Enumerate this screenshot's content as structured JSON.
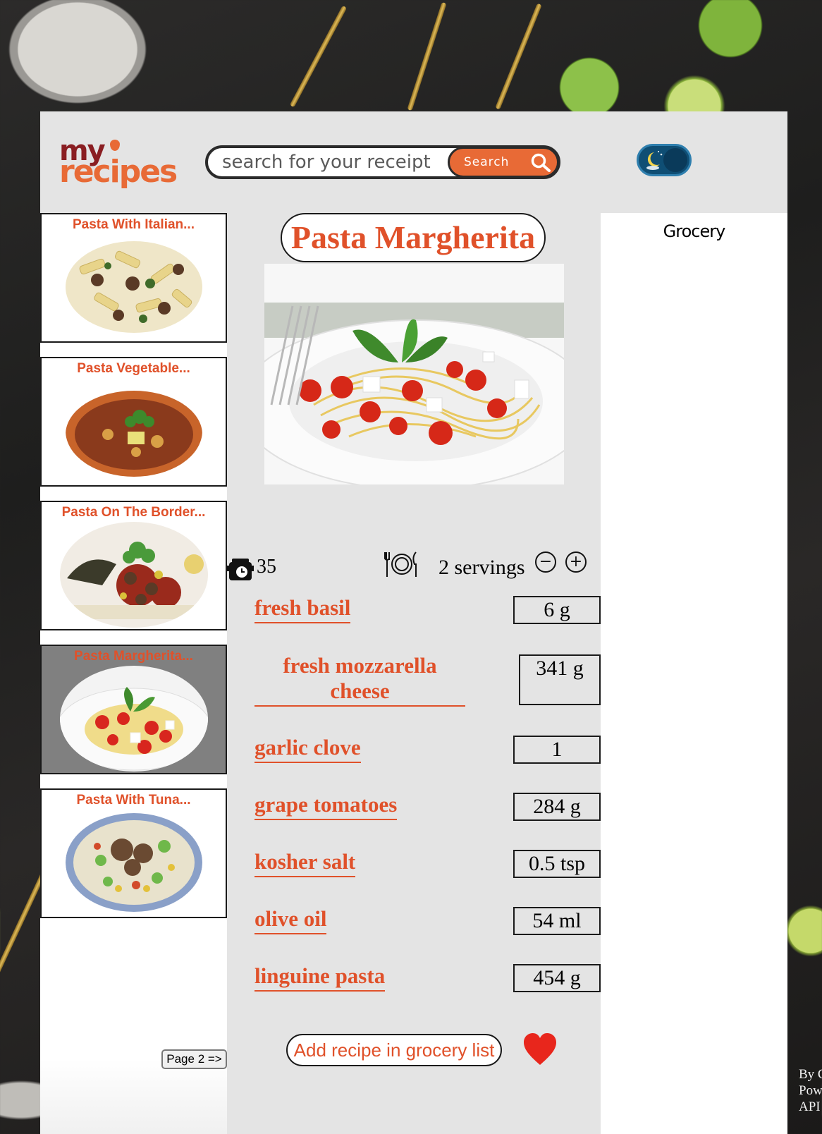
{
  "header": {
    "logo_line1": "my",
    "logo_line2": "recipes",
    "search_placeholder": "search for your receipt",
    "search_button": "Search"
  },
  "sidebar": {
    "cards": [
      {
        "title": "Pasta With Italian...",
        "active": false
      },
      {
        "title": "Pasta Vegetable...",
        "active": false
      },
      {
        "title": "Pasta On The Border...",
        "active": false
      },
      {
        "title": "Pasta Margherita...",
        "active": true
      },
      {
        "title": "Pasta With Tuna...",
        "active": false
      }
    ],
    "page_button": "Page 2 =>"
  },
  "recipe": {
    "title": "Pasta Margherita",
    "time": "35",
    "servings": "2 servings",
    "decrease_symbol": "−",
    "increase_symbol": "+",
    "ingredients": [
      {
        "name": "fresh basil",
        "amount": "6 g"
      },
      {
        "name": "fresh mozzarella cheese",
        "amount": "341 g"
      },
      {
        "name": "garlic clove",
        "amount": "1"
      },
      {
        "name": "grape tomatoes",
        "amount": "284 g"
      },
      {
        "name": "kosher salt",
        "amount": "0.5 tsp"
      },
      {
        "name": "olive oil",
        "amount": "54 ml"
      },
      {
        "name": "linguine pasta",
        "amount": "454 g"
      }
    ],
    "add_button": "Add recipe in grocery list"
  },
  "grocery": {
    "title": "Grocery"
  },
  "footer": {
    "credit": "By C\nPow\nAPI"
  },
  "colors": {
    "accent": "#e0512a",
    "brand_dark": "#8a1e22",
    "panel": "#e4e4e4",
    "heart": "#e8261c"
  }
}
